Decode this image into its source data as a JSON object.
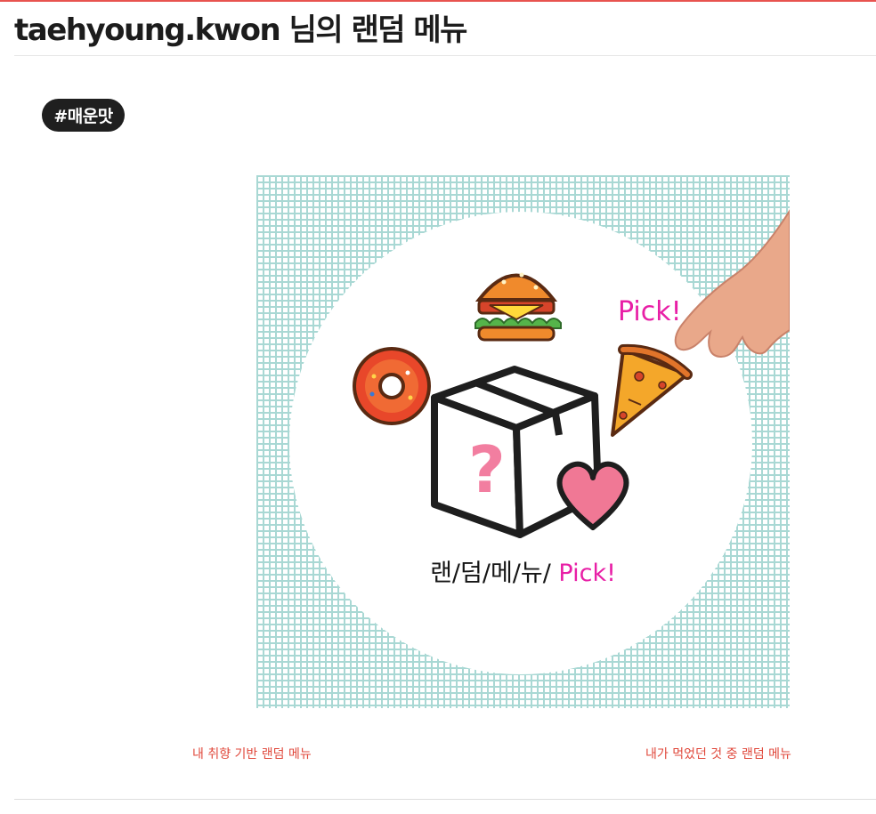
{
  "page": {
    "title": "taehyoung.kwon 님의 랜덤 메뉴",
    "accent_color": "#e8534f"
  },
  "tag": {
    "label": "#매운맛"
  },
  "hero_image": {
    "text_parts": [
      "랜/덤/메/뉴/ ",
      "Pick!"
    ],
    "pick_label": "Pick!",
    "pink_color": "#e81fa6",
    "background_grid_color": "#a9d8d4"
  },
  "links": {
    "preference_random": "내 취향 기반 랜덤 메뉴",
    "eaten_random": "내가 먹었던 것 중 랜덤 메뉴"
  }
}
